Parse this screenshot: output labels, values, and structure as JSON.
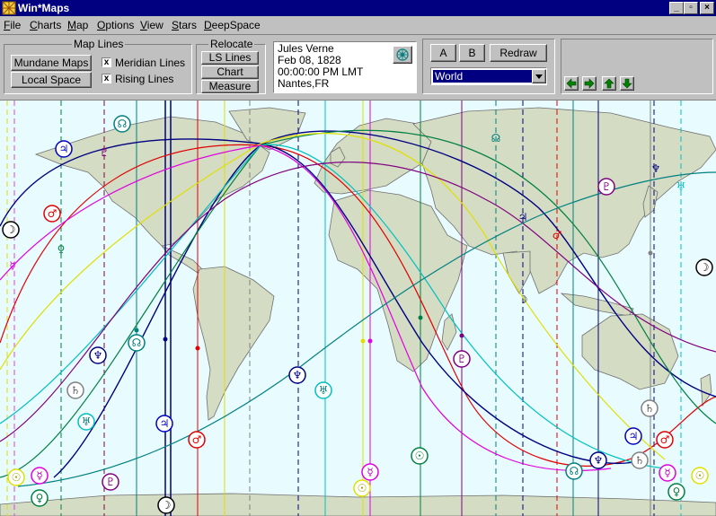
{
  "window": {
    "title": "Win*Maps",
    "min": "_",
    "max": "▫",
    "close": "×"
  },
  "menu": [
    "File",
    "Charts",
    "Map",
    "Options",
    "View",
    "Stars",
    "DeepSpace"
  ],
  "map_lines": {
    "title": "Map Lines",
    "mundane_label": "Mundane Maps",
    "local_label": "Local Space",
    "meridian_label": "Meridian Lines",
    "rising_label": "Rising Lines",
    "meridian_checked": true,
    "rising_checked": true,
    "check_mark": "x"
  },
  "relocate": {
    "title": "Relocate",
    "ls_lines": "LS  Lines",
    "chart": "Chart",
    "measure": "Measure"
  },
  "chart_info": {
    "name": "Jules Verne",
    "date": "Feb 08, 1828",
    "time": "00:00:00 PM LMT",
    "place": "Nantes,FR",
    "wheel_icon": "wheel-icon"
  },
  "controls": {
    "a": "A",
    "b": "B",
    "redraw": "Redraw",
    "region": "World"
  },
  "nav": {
    "left": "left-arrow-icon",
    "right": "right-arrow-icon",
    "up": "up-arrow-icon",
    "down": "down-arrow-icon"
  },
  "colors": {
    "sea": "#e8fbff",
    "land": "#d4dcc4",
    "title_bar": "#000080"
  },
  "planets": {
    "sun": "☉",
    "moon": "☽",
    "mercury": "☿",
    "venus": "♀",
    "mars": "♂",
    "jupiter": "♃",
    "saturn": "♄",
    "uranus": "♅",
    "neptune": "♆",
    "pluto": "♇",
    "node": "☊"
  }
}
